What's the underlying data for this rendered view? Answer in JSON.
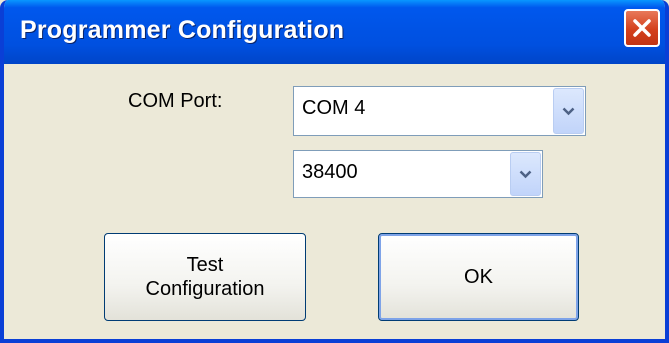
{
  "window": {
    "title": "Programmer Configuration"
  },
  "form": {
    "com_port_label": "COM Port:",
    "com_port_value": "COM 4",
    "baud_rate_value": "38400"
  },
  "buttons": {
    "test_line1": "Test",
    "test_line2": "Configuration",
    "ok": "OK"
  },
  "icons": {
    "close": "close-icon",
    "dropdown": "chevron-down-icon"
  },
  "colors": {
    "titlebar": "#0053e5",
    "close": "#d4401c",
    "dialog_bg": "#ece9d8"
  }
}
